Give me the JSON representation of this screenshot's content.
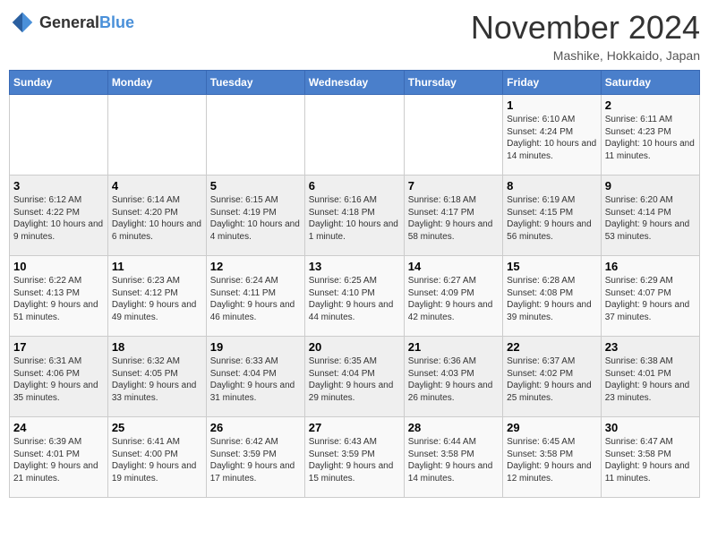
{
  "header": {
    "logo_general": "General",
    "logo_blue": "Blue",
    "month_title": "November 2024",
    "location": "Mashike, Hokkaido, Japan"
  },
  "weekdays": [
    "Sunday",
    "Monday",
    "Tuesday",
    "Wednesday",
    "Thursday",
    "Friday",
    "Saturday"
  ],
  "weeks": [
    [
      {
        "day": "",
        "sunrise": "",
        "sunset": "",
        "daylight": ""
      },
      {
        "day": "",
        "sunrise": "",
        "sunset": "",
        "daylight": ""
      },
      {
        "day": "",
        "sunrise": "",
        "sunset": "",
        "daylight": ""
      },
      {
        "day": "",
        "sunrise": "",
        "sunset": "",
        "daylight": ""
      },
      {
        "day": "",
        "sunrise": "",
        "sunset": "",
        "daylight": ""
      },
      {
        "day": "1",
        "sunrise": "Sunrise: 6:10 AM",
        "sunset": "Sunset: 4:24 PM",
        "daylight": "Daylight: 10 hours and 14 minutes."
      },
      {
        "day": "2",
        "sunrise": "Sunrise: 6:11 AM",
        "sunset": "Sunset: 4:23 PM",
        "daylight": "Daylight: 10 hours and 11 minutes."
      }
    ],
    [
      {
        "day": "3",
        "sunrise": "Sunrise: 6:12 AM",
        "sunset": "Sunset: 4:22 PM",
        "daylight": "Daylight: 10 hours and 9 minutes."
      },
      {
        "day": "4",
        "sunrise": "Sunrise: 6:14 AM",
        "sunset": "Sunset: 4:20 PM",
        "daylight": "Daylight: 10 hours and 6 minutes."
      },
      {
        "day": "5",
        "sunrise": "Sunrise: 6:15 AM",
        "sunset": "Sunset: 4:19 PM",
        "daylight": "Daylight: 10 hours and 4 minutes."
      },
      {
        "day": "6",
        "sunrise": "Sunrise: 6:16 AM",
        "sunset": "Sunset: 4:18 PM",
        "daylight": "Daylight: 10 hours and 1 minute."
      },
      {
        "day": "7",
        "sunrise": "Sunrise: 6:18 AM",
        "sunset": "Sunset: 4:17 PM",
        "daylight": "Daylight: 9 hours and 58 minutes."
      },
      {
        "day": "8",
        "sunrise": "Sunrise: 6:19 AM",
        "sunset": "Sunset: 4:15 PM",
        "daylight": "Daylight: 9 hours and 56 minutes."
      },
      {
        "day": "9",
        "sunrise": "Sunrise: 6:20 AM",
        "sunset": "Sunset: 4:14 PM",
        "daylight": "Daylight: 9 hours and 53 minutes."
      }
    ],
    [
      {
        "day": "10",
        "sunrise": "Sunrise: 6:22 AM",
        "sunset": "Sunset: 4:13 PM",
        "daylight": "Daylight: 9 hours and 51 minutes."
      },
      {
        "day": "11",
        "sunrise": "Sunrise: 6:23 AM",
        "sunset": "Sunset: 4:12 PM",
        "daylight": "Daylight: 9 hours and 49 minutes."
      },
      {
        "day": "12",
        "sunrise": "Sunrise: 6:24 AM",
        "sunset": "Sunset: 4:11 PM",
        "daylight": "Daylight: 9 hours and 46 minutes."
      },
      {
        "day": "13",
        "sunrise": "Sunrise: 6:25 AM",
        "sunset": "Sunset: 4:10 PM",
        "daylight": "Daylight: 9 hours and 44 minutes."
      },
      {
        "day": "14",
        "sunrise": "Sunrise: 6:27 AM",
        "sunset": "Sunset: 4:09 PM",
        "daylight": "Daylight: 9 hours and 42 minutes."
      },
      {
        "day": "15",
        "sunrise": "Sunrise: 6:28 AM",
        "sunset": "Sunset: 4:08 PM",
        "daylight": "Daylight: 9 hours and 39 minutes."
      },
      {
        "day": "16",
        "sunrise": "Sunrise: 6:29 AM",
        "sunset": "Sunset: 4:07 PM",
        "daylight": "Daylight: 9 hours and 37 minutes."
      }
    ],
    [
      {
        "day": "17",
        "sunrise": "Sunrise: 6:31 AM",
        "sunset": "Sunset: 4:06 PM",
        "daylight": "Daylight: 9 hours and 35 minutes."
      },
      {
        "day": "18",
        "sunrise": "Sunrise: 6:32 AM",
        "sunset": "Sunset: 4:05 PM",
        "daylight": "Daylight: 9 hours and 33 minutes."
      },
      {
        "day": "19",
        "sunrise": "Sunrise: 6:33 AM",
        "sunset": "Sunset: 4:04 PM",
        "daylight": "Daylight: 9 hours and 31 minutes."
      },
      {
        "day": "20",
        "sunrise": "Sunrise: 6:35 AM",
        "sunset": "Sunset: 4:04 PM",
        "daylight": "Daylight: 9 hours and 29 minutes."
      },
      {
        "day": "21",
        "sunrise": "Sunrise: 6:36 AM",
        "sunset": "Sunset: 4:03 PM",
        "daylight": "Daylight: 9 hours and 26 minutes."
      },
      {
        "day": "22",
        "sunrise": "Sunrise: 6:37 AM",
        "sunset": "Sunset: 4:02 PM",
        "daylight": "Daylight: 9 hours and 25 minutes."
      },
      {
        "day": "23",
        "sunrise": "Sunrise: 6:38 AM",
        "sunset": "Sunset: 4:01 PM",
        "daylight": "Daylight: 9 hours and 23 minutes."
      }
    ],
    [
      {
        "day": "24",
        "sunrise": "Sunrise: 6:39 AM",
        "sunset": "Sunset: 4:01 PM",
        "daylight": "Daylight: 9 hours and 21 minutes."
      },
      {
        "day": "25",
        "sunrise": "Sunrise: 6:41 AM",
        "sunset": "Sunset: 4:00 PM",
        "daylight": "Daylight: 9 hours and 19 minutes."
      },
      {
        "day": "26",
        "sunrise": "Sunrise: 6:42 AM",
        "sunset": "Sunset: 3:59 PM",
        "daylight": "Daylight: 9 hours and 17 minutes."
      },
      {
        "day": "27",
        "sunrise": "Sunrise: 6:43 AM",
        "sunset": "Sunset: 3:59 PM",
        "daylight": "Daylight: 9 hours and 15 minutes."
      },
      {
        "day": "28",
        "sunrise": "Sunrise: 6:44 AM",
        "sunset": "Sunset: 3:58 PM",
        "daylight": "Daylight: 9 hours and 14 minutes."
      },
      {
        "day": "29",
        "sunrise": "Sunrise: 6:45 AM",
        "sunset": "Sunset: 3:58 PM",
        "daylight": "Daylight: 9 hours and 12 minutes."
      },
      {
        "day": "30",
        "sunrise": "Sunrise: 6:47 AM",
        "sunset": "Sunset: 3:58 PM",
        "daylight": "Daylight: 9 hours and 11 minutes."
      }
    ]
  ]
}
